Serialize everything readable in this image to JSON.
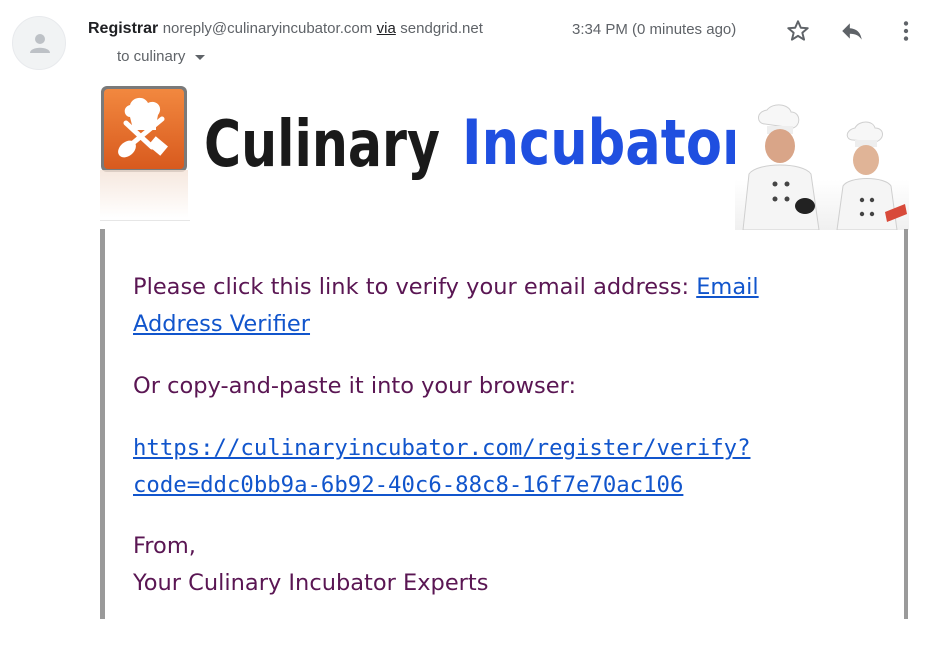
{
  "header": {
    "sender_name": "Registrar",
    "sender_email": "noreply@culinaryincubator.com",
    "via_label": "via",
    "via_domain": "sendgrid.net",
    "time": "3:34 PM (0 minutes ago)",
    "to_line": "to culinary",
    "icons": [
      "avatar-person-icon",
      "star-icon",
      "reply-icon",
      "more-vertical-icon",
      "chevron-down-icon"
    ]
  },
  "banner": {
    "brand_word_1": "Culinary",
    "brand_word_2": "Incubator",
    "colors": {
      "logo_orange": "#e8692c",
      "word_dark": "#1a1a1a",
      "word_blue": "#1f4fe0"
    }
  },
  "body": {
    "verify_text": "Please click this link to verify your email address: ",
    "verify_link": "Email Address Verifier",
    "copy_text": "Or copy-and-paste it into your browser:",
    "url": "https://culinaryincubator.com/register/verify?code=ddc0bb9a-6b92-40c6-88c8-16f7e70ac106",
    "sign_from": "From,",
    "sign_name": "Your Culinary Incubator Experts"
  },
  "colors": {
    "body_text": "#5a1653",
    "link": "#1155cc",
    "panel_border": "#9a9a9a"
  }
}
